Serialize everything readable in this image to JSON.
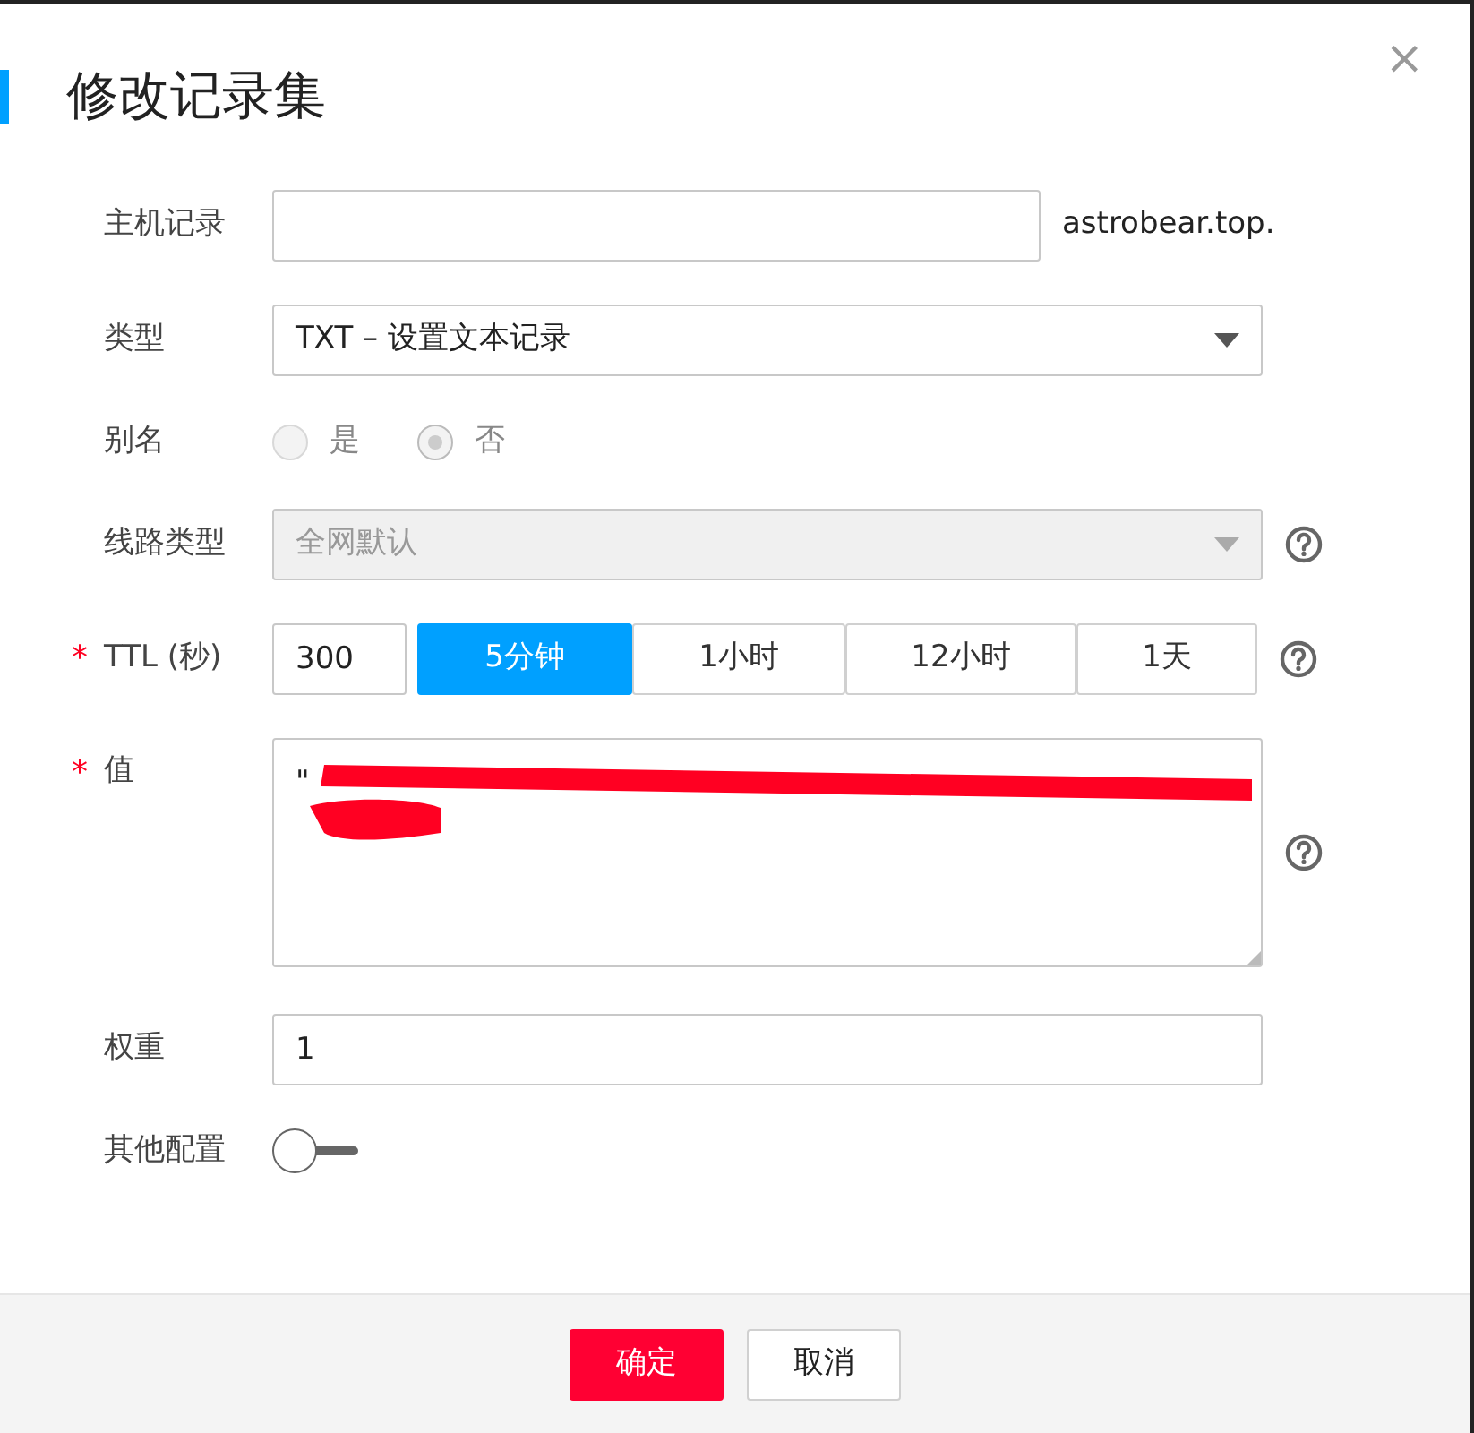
{
  "dialog": {
    "title": "修改记录集",
    "close": "×"
  },
  "fields": [
    {
      "kind": "text",
      "label": "主机记录",
      "suffix": "astrobear.top."
    },
    {
      "kind": "select",
      "label": "类型",
      "value": "TXT – 设置文本记录",
      "disabled": false
    },
    {
      "kind": "radio",
      "label": "别名",
      "options": [
        {
          "label": "是",
          "selected": false
        },
        {
          "label": "否",
          "selected": true
        }
      ],
      "disabled": true
    },
    {
      "kind": "select",
      "label": "线路类型",
      "value": "全网默认",
      "disabled": true,
      "help": true
    },
    {
      "kind": "ttl",
      "label": "TTL (秒)",
      "required_mark": "*",
      "value": "300",
      "presets": [
        {
          "label": "5分钟",
          "selected": true
        },
        {
          "label": "1小时",
          "selected": false
        },
        {
          "label": "12小时",
          "selected": false
        },
        {
          "label": "1天",
          "selected": false
        }
      ],
      "help": true
    },
    {
      "kind": "textarea",
      "label": "值",
      "required_mark": "*",
      "value": "\"",
      "redacted": true,
      "help": true
    },
    {
      "kind": "text",
      "label": "权重",
      "value": "1"
    },
    {
      "kind": "toggle",
      "label": "其他配置",
      "on": false
    }
  ],
  "footer": {
    "buttons": [
      {
        "label": "确定",
        "kind": "primary"
      },
      {
        "label": "取消",
        "kind": "secondary"
      }
    ]
  }
}
